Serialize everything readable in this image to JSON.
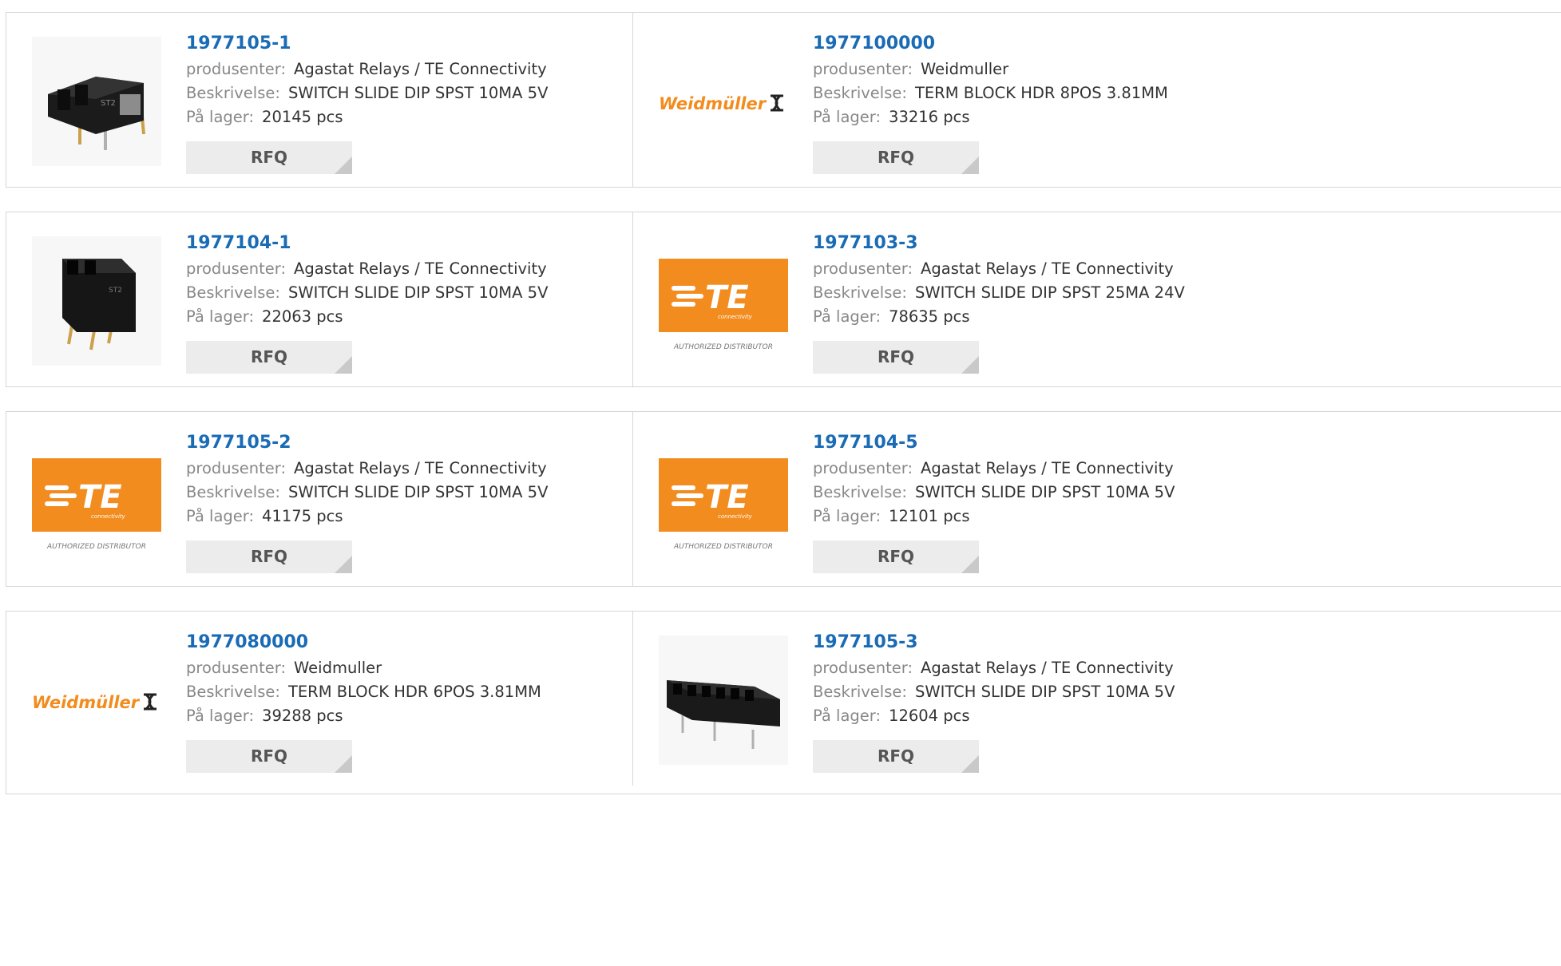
{
  "labels": {
    "manufacturer": "produsenter:",
    "description": "Beskrivelse:",
    "stock": "På lager:",
    "rfq": "RFQ"
  },
  "colors": {
    "accent": "#1a6bb5",
    "te_orange": "#f28c1e",
    "weidmuller_orange": "#f28c1e"
  },
  "products": [
    {
      "part": "1977105-1",
      "manufacturer": "Agastat Relays / TE Connectivity",
      "description": "SWITCH SLIDE DIP SPST 10MA 5V",
      "stock": "20145 pcs",
      "image": "dip-switch-2pos-photo"
    },
    {
      "part": "1977100000",
      "manufacturer": "Weidmuller",
      "description": "TERM BLOCK HDR 8POS 3.81MM",
      "stock": "33216 pcs",
      "image": "weidmuller-logo",
      "logo_text": "Weidmüller"
    },
    {
      "part": "1977104-1",
      "manufacturer": "Agastat Relays / TE Connectivity",
      "description": "SWITCH SLIDE DIP SPST 10MA 5V",
      "stock": "22063 pcs",
      "image": "dip-switch-2pos-upright-photo"
    },
    {
      "part": "1977103-3",
      "manufacturer": "Agastat Relays / TE Connectivity",
      "description": "SWITCH SLIDE DIP SPST 25MA 24V",
      "stock": "78635 pcs",
      "image": "te-logo",
      "logo_text": "TE",
      "logo_sub": "connectivity",
      "logo_caption": "AUTHORIZED DISTRIBUTOR"
    },
    {
      "part": "1977105-2",
      "manufacturer": "Agastat Relays / TE Connectivity",
      "description": "SWITCH SLIDE DIP SPST 10MA 5V",
      "stock": "41175 pcs",
      "image": "te-logo",
      "logo_text": "TE",
      "logo_sub": "connectivity",
      "logo_caption": "AUTHORIZED DISTRIBUTOR"
    },
    {
      "part": "1977104-5",
      "manufacturer": "Agastat Relays / TE Connectivity",
      "description": "SWITCH SLIDE DIP SPST 10MA 5V",
      "stock": "12101 pcs",
      "image": "te-logo",
      "logo_text": "TE",
      "logo_sub": "connectivity",
      "logo_caption": "AUTHORIZED DISTRIBUTOR"
    },
    {
      "part": "1977080000",
      "manufacturer": "Weidmuller",
      "description": "TERM BLOCK HDR 6POS 3.81MM",
      "stock": "39288 pcs",
      "image": "weidmuller-logo",
      "logo_text": "Weidmüller"
    },
    {
      "part": "1977105-3",
      "manufacturer": "Agastat Relays / TE Connectivity",
      "description": "SWITCH SLIDE DIP SPST 10MA 5V",
      "stock": "12604 pcs",
      "image": "dip-switch-6pos-photo"
    }
  ]
}
